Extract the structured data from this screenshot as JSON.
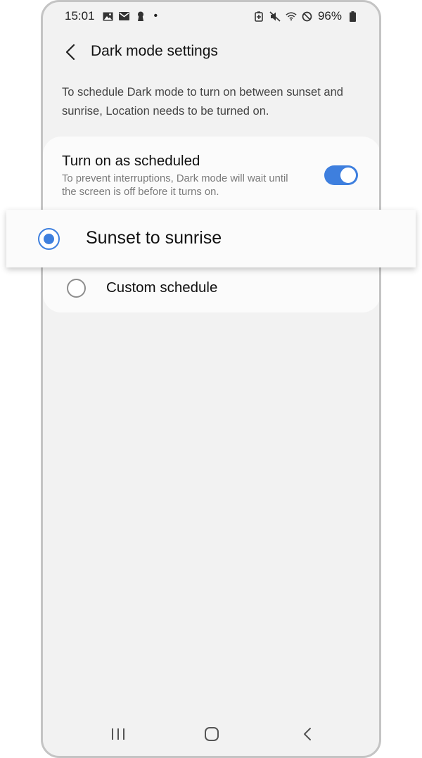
{
  "status_bar": {
    "time": "15:01",
    "left_icons": [
      "gallery-icon",
      "mail-icon",
      "keyhole-icon"
    ],
    "dot": "•",
    "right_icons": [
      "battery-saver-icon",
      "mute-icon",
      "wifi-icon",
      "do-not-disturb-icon"
    ],
    "battery": "96%"
  },
  "header": {
    "title": "Dark mode settings"
  },
  "description": "To schedule Dark mode to turn on between sunset and sunrise, Location needs to be turned on.",
  "schedule": {
    "title": "Turn on as scheduled",
    "subtitle": "To prevent interruptions, Dark mode will wait until the screen is off before it turns on.",
    "enabled": true
  },
  "options": [
    {
      "label": "Sunset to sunrise",
      "selected": true
    },
    {
      "label": "Custom schedule",
      "selected": false
    }
  ],
  "nav": [
    "recent-apps-icon",
    "home-icon",
    "back-icon"
  ],
  "colors": {
    "accent": "#3e7fde",
    "background": "#f2f2f2",
    "card": "#fbfbfb"
  }
}
